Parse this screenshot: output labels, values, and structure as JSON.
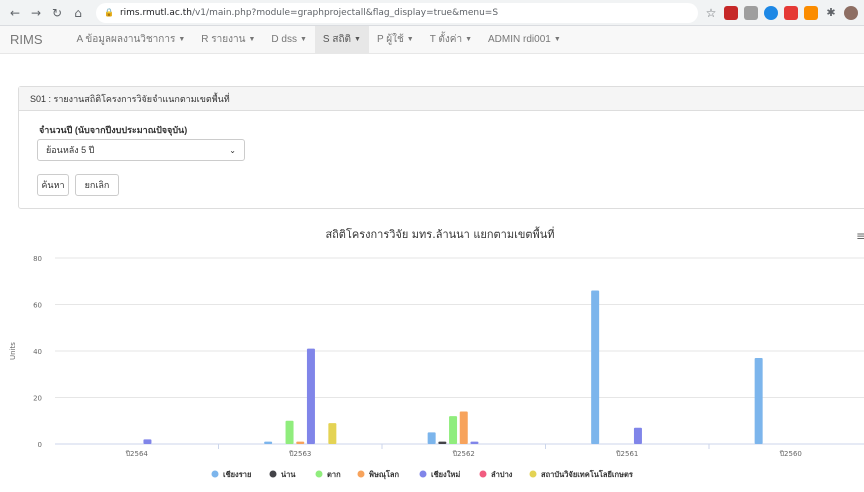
{
  "browser": {
    "url_host": "rims.rmutl.ac.th",
    "url_path": "/v1/main.php?module=graphprojectall&flag_display=true&menu=S"
  },
  "navbar": {
    "brand": "RIMS",
    "items": [
      {
        "label": "A ข้อมูลผลงานวิชาการ",
        "active": false
      },
      {
        "label": "R รายงาน",
        "active": false
      },
      {
        "label": "D dss",
        "active": false
      },
      {
        "label": "S สถิติ",
        "active": true
      },
      {
        "label": "P ผู้ใช้",
        "active": false
      },
      {
        "label": "T ตั้งค่า",
        "active": false
      },
      {
        "label": "ADMIN rdi001",
        "active": false
      }
    ]
  },
  "panel": {
    "heading": "S01 : รายงานสถิติโครงการวิจัยจำแนกตามเขตพื้นที่",
    "field_label": "จำนวนปี (นับจากปีงบประมาณปัจจุบัน)",
    "select_value": "ย้อนหลัง 5 ปี",
    "search_button": "ค้นหา",
    "cancel_button": "ยกเลิก"
  },
  "chart_data": {
    "type": "bar",
    "title": "สถิติโครงการวิจัย มทร.ล้านนา แยกตามเขตพื้นที่",
    "ylabel": "Units",
    "ylim": [
      0,
      80
    ],
    "yticks": [
      0,
      20,
      40,
      60,
      80
    ],
    "grid": true,
    "legend": "bottom",
    "categories": [
      "ปี2564",
      "ปี2563",
      "ปี2562",
      "ปี2561",
      "ปี2560"
    ],
    "series": [
      {
        "name": "เชียงราย",
        "color": "#7cb5ec",
        "values": [
          0,
          1,
          5,
          66,
          37
        ]
      },
      {
        "name": "น่าน",
        "color": "#434348",
        "values": [
          0,
          0,
          1,
          0,
          0
        ]
      },
      {
        "name": "ตาก",
        "color": "#90ed7d",
        "values": [
          0,
          10,
          12,
          0,
          0
        ]
      },
      {
        "name": "พิษณุโลก",
        "color": "#f7a35c",
        "values": [
          0,
          1,
          14,
          0,
          0
        ]
      },
      {
        "name": "เชียงใหม่",
        "color": "#8085e9",
        "values": [
          2,
          41,
          1,
          7,
          0
        ]
      },
      {
        "name": "ลำปาง",
        "color": "#f15c80",
        "values": [
          0,
          0,
          0,
          0,
          0
        ]
      },
      {
        "name": "สถาบันวิจัยเทคโนโลยีเกษตร",
        "color": "#e4d354",
        "values": [
          0,
          9,
          0,
          0,
          0
        ]
      }
    ]
  }
}
